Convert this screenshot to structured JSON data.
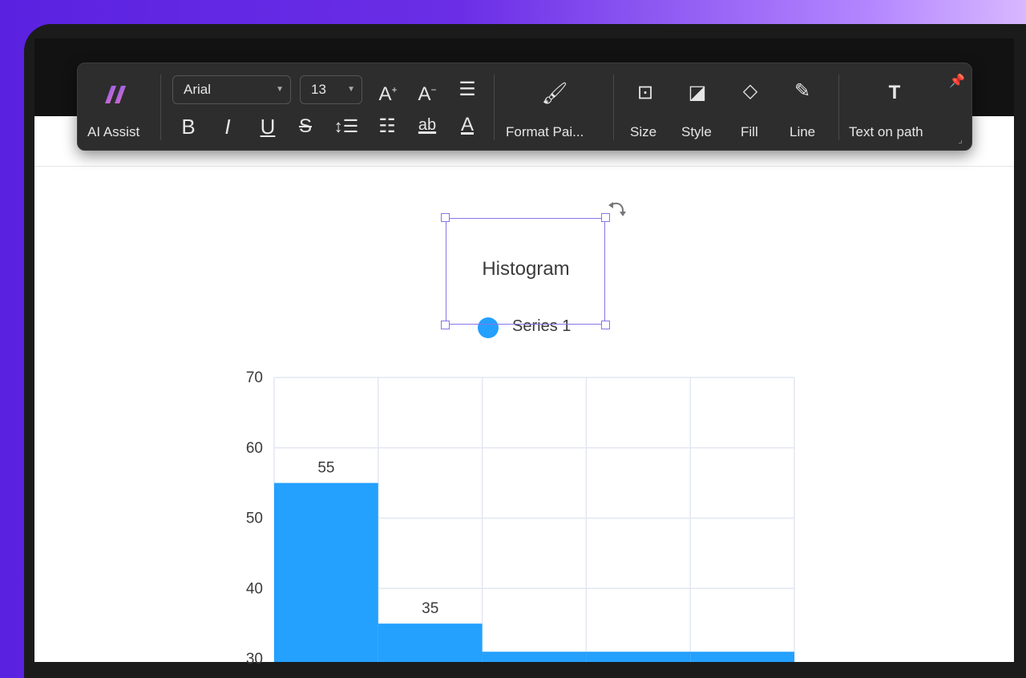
{
  "toolbar": {
    "ai_assist": "AI Assist",
    "font_family": "Arial",
    "font_size": "13",
    "format_painter": "Format Pai...",
    "size": "Size",
    "style": "Style",
    "fill": "Fill",
    "line": "Line",
    "text_on_path": "Text on path"
  },
  "colors": {
    "accent": "#8a74e8",
    "bar": "#24a0ff",
    "toolbar_bg": "#2d2d2d"
  },
  "chart_data": {
    "type": "bar",
    "title": "Histogram",
    "legend": "top",
    "series": [
      {
        "name": "Series 1",
        "values": [
          55,
          35,
          31,
          31,
          31
        ]
      }
    ],
    "y_ticks": [
      "70",
      "60",
      "50",
      "40",
      "30"
    ],
    "data_labels": [
      "55",
      "35"
    ],
    "ylim": [
      30,
      70
    ],
    "grid": true
  }
}
